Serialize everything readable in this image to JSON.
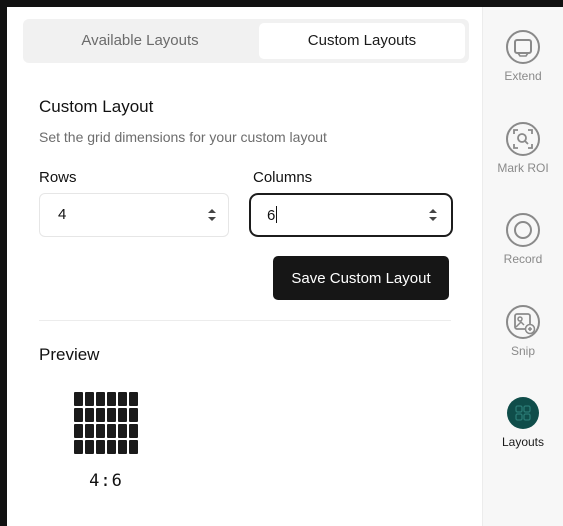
{
  "tabs": {
    "available": "Available Layouts",
    "custom": "Custom Layouts"
  },
  "custom_layout": {
    "title": "Custom Layout",
    "subtitle": "Set the grid dimensions for your custom layout",
    "rows_label": "Rows",
    "rows_value": "4",
    "columns_label": "Columns",
    "columns_value": "6",
    "save_label": "Save Custom Layout"
  },
  "preview": {
    "title": "Preview",
    "rows": 4,
    "columns": 6,
    "caption": "4:6"
  },
  "sidebar": {
    "items": [
      {
        "label": "Extend",
        "icon": "extend-icon"
      },
      {
        "label": "Mark ROI",
        "icon": "mark-roi-icon"
      },
      {
        "label": "Record",
        "icon": "record-icon"
      },
      {
        "label": "Snip",
        "icon": "snip-icon"
      },
      {
        "label": "Layouts",
        "icon": "layouts-icon",
        "active": true
      }
    ]
  },
  "colors": {
    "accent": "#0f4d4a",
    "button": "#161616",
    "icon_gray": "#8a8a8a"
  }
}
